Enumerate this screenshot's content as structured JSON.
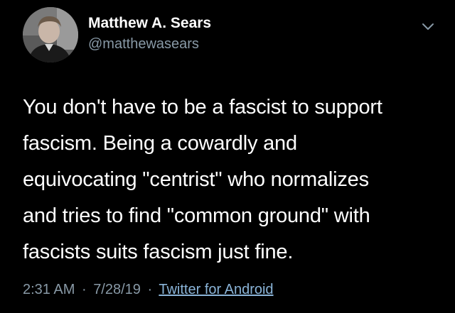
{
  "author": {
    "display_name": "Matthew A. Sears",
    "handle": "@matthewasears",
    "avatar_icon": "user-avatar"
  },
  "menu_icon": "chevron-down-icon",
  "tweet": {
    "lines": [
      "You don't have to be a fascist to support",
      "fascism. Being a cowardly and",
      "equivocating \"centrist\" who normalizes",
      "and tries to find \"common ground\" with",
      "fascists suits fascism just fine."
    ]
  },
  "meta": {
    "time": "2:31 AM",
    "separator": "·",
    "date": "7/28/19",
    "source": "Twitter for Android"
  },
  "colors": {
    "background": "#000000",
    "text": "#ffffff",
    "secondary": "#8899a6",
    "link": "#8ab4d8"
  }
}
